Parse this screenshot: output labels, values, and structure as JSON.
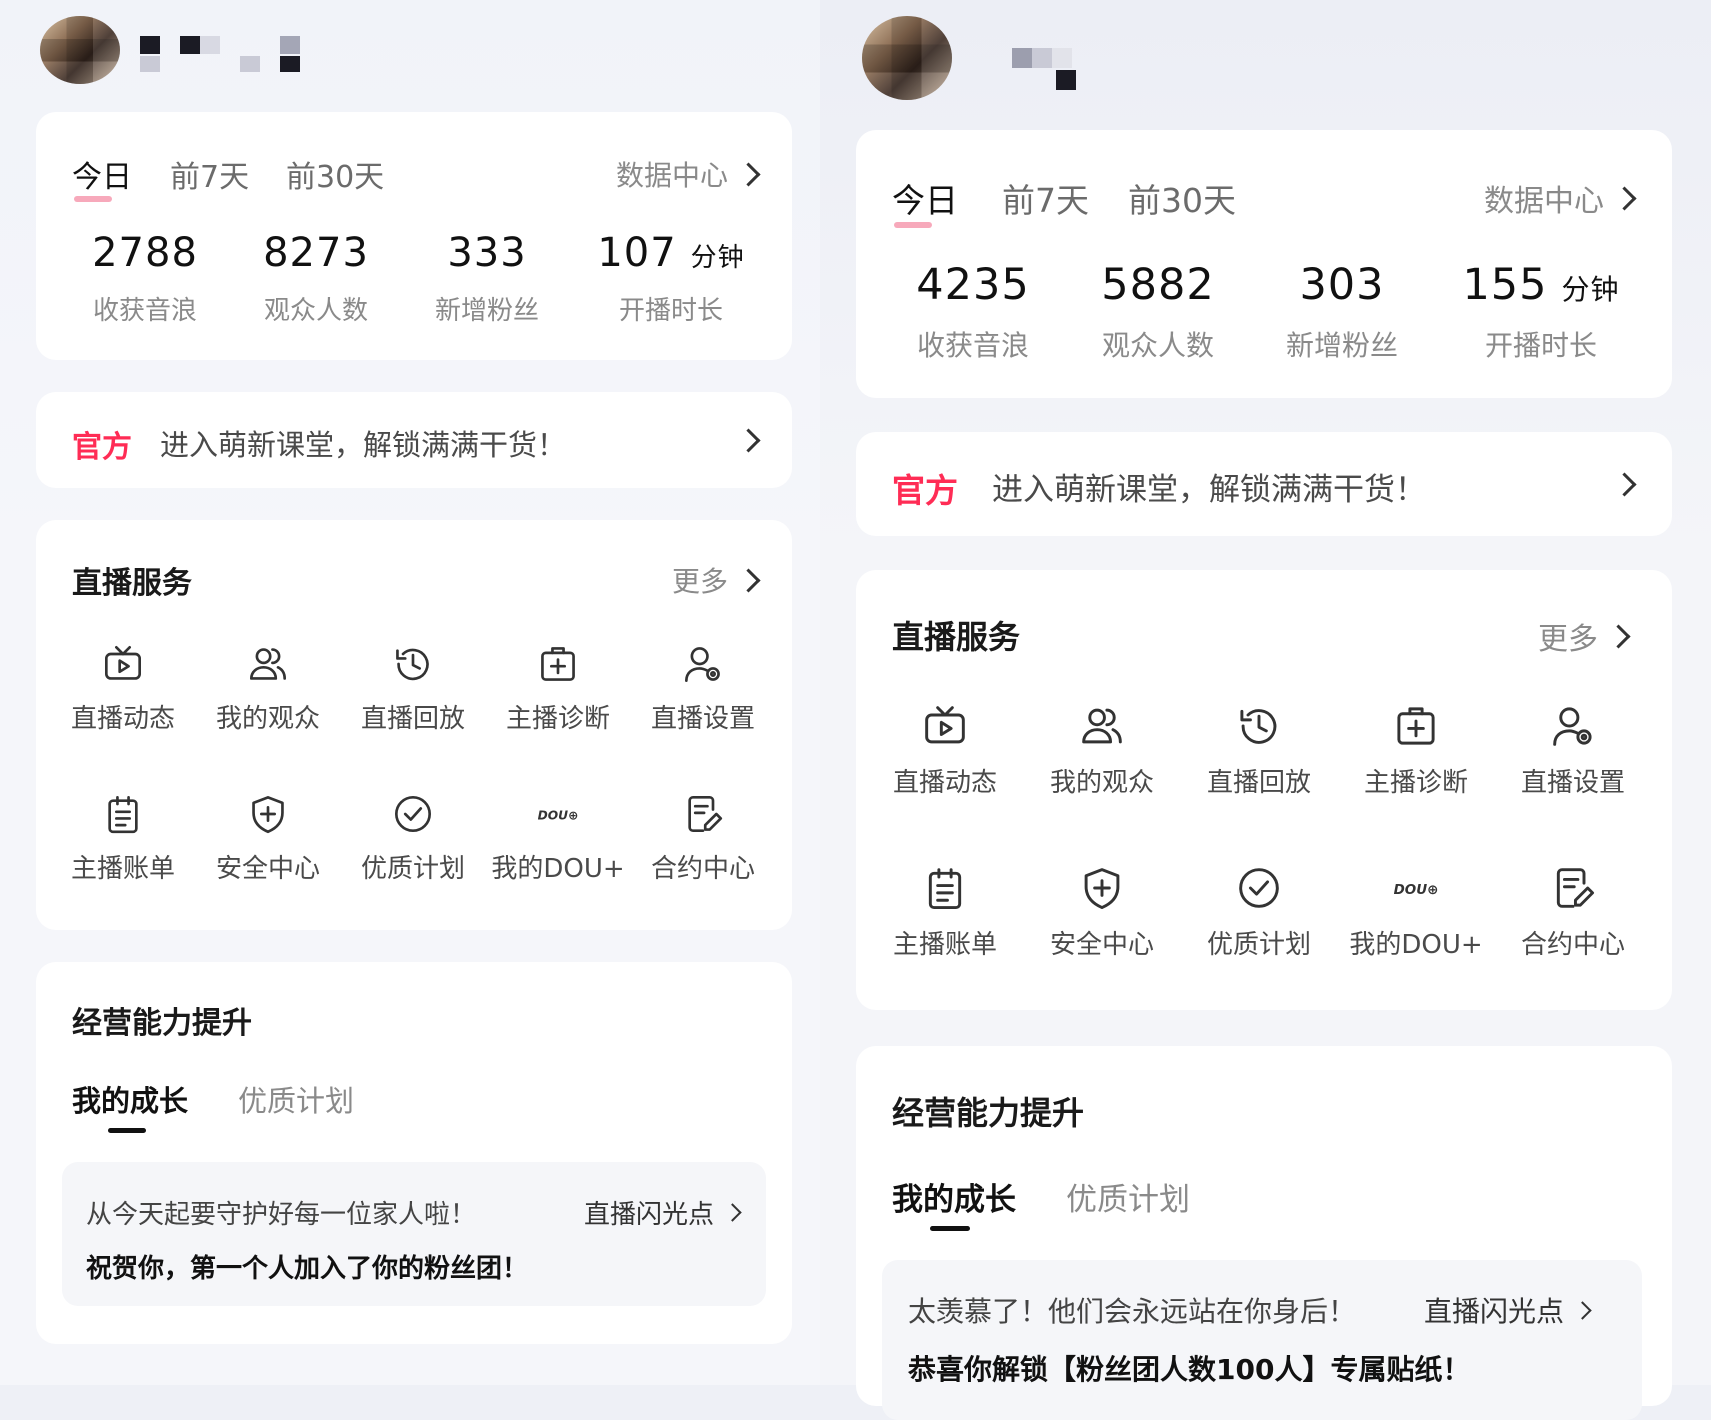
{
  "panels": [
    {
      "tabs": [
        "今日",
        "前7天",
        "前30天"
      ],
      "data_center": "数据中心",
      "stats": [
        {
          "value": "2788",
          "unit": "",
          "label": "收获音浪"
        },
        {
          "value": "8273",
          "unit": "",
          "label": "观众人数"
        },
        {
          "value": "333",
          "unit": "",
          "label": "新增粉丝"
        },
        {
          "value": "107",
          "unit": "分钟",
          "label": "开播时长"
        }
      ],
      "banner": {
        "tag": "官方",
        "text": "进入萌新课堂，解锁满满干货！"
      },
      "services": {
        "title": "直播服务",
        "more": "更多",
        "items": [
          {
            "label": "直播动态",
            "icon": "live-tv-icon"
          },
          {
            "label": "我的观众",
            "icon": "audience-icon"
          },
          {
            "label": "直播回放",
            "icon": "replay-icon"
          },
          {
            "label": "主播诊断",
            "icon": "diagnosis-icon"
          },
          {
            "label": "直播设置",
            "icon": "settings-user-icon"
          },
          {
            "label": "主播账单",
            "icon": "bill-icon"
          },
          {
            "label": "安全中心",
            "icon": "shield-icon"
          },
          {
            "label": "优质计划",
            "icon": "check-circle-icon"
          },
          {
            "label": "我的DOU+",
            "icon": "dou-icon"
          },
          {
            "label": "合约中心",
            "icon": "contract-icon"
          }
        ]
      },
      "growth": {
        "title": "经营能力提升",
        "tabs": [
          "我的成长",
          "优质计划"
        ],
        "notice_line1": "从今天起要守护好每一位家人啦！",
        "notice_line2": "祝贺你，第一个人加入了你的粉丝团！",
        "notice_link": "直播闪光点"
      }
    },
    {
      "tabs": [
        "今日",
        "前7天",
        "前30天"
      ],
      "data_center": "数据中心",
      "stats": [
        {
          "value": "4235",
          "unit": "",
          "label": "收获音浪"
        },
        {
          "value": "5882",
          "unit": "",
          "label": "观众人数"
        },
        {
          "value": "303",
          "unit": "",
          "label": "新增粉丝"
        },
        {
          "value": "155",
          "unit": "分钟",
          "label": "开播时长"
        }
      ],
      "banner": {
        "tag": "官方",
        "text": "进入萌新课堂，解锁满满干货！"
      },
      "services": {
        "title": "直播服务",
        "more": "更多",
        "items": [
          {
            "label": "直播动态",
            "icon": "live-tv-icon"
          },
          {
            "label": "我的观众",
            "icon": "audience-icon"
          },
          {
            "label": "直播回放",
            "icon": "replay-icon"
          },
          {
            "label": "主播诊断",
            "icon": "diagnosis-icon"
          },
          {
            "label": "直播设置",
            "icon": "settings-user-icon"
          },
          {
            "label": "主播账单",
            "icon": "bill-icon"
          },
          {
            "label": "安全中心",
            "icon": "shield-icon"
          },
          {
            "label": "优质计划",
            "icon": "check-circle-icon"
          },
          {
            "label": "我的DOU+",
            "icon": "dou-icon"
          },
          {
            "label": "合约中心",
            "icon": "contract-icon"
          }
        ]
      },
      "growth": {
        "title": "经营能力提升",
        "tabs": [
          "我的成长",
          "优质计划"
        ],
        "notice_line1": "太羡慕了！他们会永远站在你身后！",
        "notice_line2": "恭喜你解锁【粉丝团人数100人】专属贴纸！",
        "notice_link": "直播闪光点"
      }
    }
  ],
  "icon_svgs": {
    "live-tv-icon": "<rect x='3' y='9' width='30' height='22' rx='4'/><path d='M12 3l6 6 6-6'/><path d='M15 15v10l8-5z'/>",
    "audience-icon": "<circle cx='14' cy='11' r='6'/><path d='M3 31c0-6 5-10 11-10s11 4 11 10z'/><path d='M22 5a6 6 0 0 1 0 12'/><path d='M27 21c4 2 6 5 6 10'/>",
    "replay-icon": "<path d='M5 18a13 13 0 1 0 4-9'/><path d='M4 6v7h7'/><path d='M18 10v9l6 3'/>",
    "diagnosis-icon": "<rect x='4' y='8' width='28' height='24' rx='3'/><path d='M13 8V4h10v4'/><path d='M18 14v12M12 20h12'/>",
    "settings-user-icon": "<circle cx='15' cy='11' r='7'/><path d='M3 33c0-7 5-11 12-11 3 0 5 1 7 2'/><circle cx='27' cy='27' r='5'/><circle cx='27' cy='27' r='1.5'/>",
    "bill-icon": "<rect x='6' y='6' width='24' height='28' rx='3'/><path d='M13 3v6M23 3v6M12 16h12M12 22h12M12 28h8'/>",
    "shield-icon": "<path d='M18 3l13 5v9c0 9-6 14-13 17-7-3-13-8-13-17V8z'/><path d='M18 12v12M12 18h12'/>",
    "check-circle-icon": "<circle cx='18' cy='18' r='15'/><path d='M11 18l5 5 9-10'/>",
    "contract-icon": "<path d='M27 14V6a3 3 0 0 0-3-3H9a3 3 0 0 0-3 3v24a3 3 0 0 0 3 3h9'/><path d='M11 11h11M11 17h8'/><path d='M30 18l4 4-10 10h-4v-4z'/>"
  }
}
